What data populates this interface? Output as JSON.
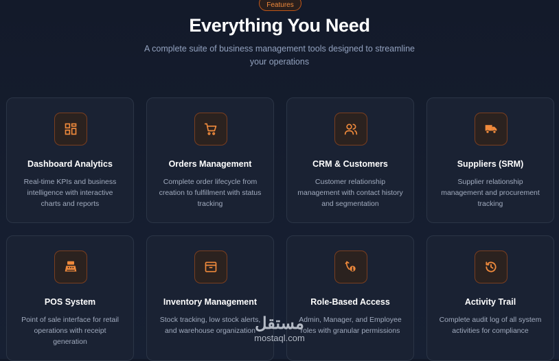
{
  "header": {
    "badge": "Features",
    "title": "Everything You Need",
    "subtitle": "A complete suite of business management tools designed to streamline your operations"
  },
  "accent_color": "#f08a3c",
  "features": [
    {
      "title": "Dashboard Analytics",
      "desc": "Real-time KPIs and business intelligence with interactive charts and reports",
      "icon": "dashboard-icon"
    },
    {
      "title": "Orders Management",
      "desc": "Complete order lifecycle from creation to fulfillment with status tracking",
      "icon": "cart-icon"
    },
    {
      "title": "CRM & Customers",
      "desc": "Customer relationship management with contact history and segmentation",
      "icon": "users-icon"
    },
    {
      "title": "Suppliers (SRM)",
      "desc": "Supplier relationship management and procurement tracking",
      "icon": "truck-icon"
    },
    {
      "title": "POS System",
      "desc": "Point of sale interface for retail operations with receipt generation",
      "icon": "cash-register-icon"
    },
    {
      "title": "Inventory Management",
      "desc": "Stock tracking, low stock alerts, and warehouse organization",
      "icon": "archive-box-icon"
    },
    {
      "title": "Role-Based Access",
      "desc": "Admin, Manager, and Employee roles with granular permissions",
      "icon": "role-access-icon"
    },
    {
      "title": "Activity Trail",
      "desc": "Complete audit log of all system activities for compliance",
      "icon": "history-icon"
    }
  ],
  "watermark": {
    "arabic": "مستقل",
    "latin": "mostaql.com"
  }
}
